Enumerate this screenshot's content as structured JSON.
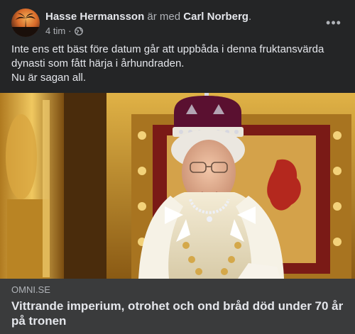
{
  "post": {
    "author": "Hasse Hermansson",
    "with_text": "är med",
    "tagged": "Carl Norberg",
    "tag_end": ".",
    "time": "4 tim",
    "dot": "·",
    "audience_icon": "globe-icon",
    "more_icon": "more-options-icon",
    "more_glyph": "•••",
    "body_lines": [
      "Inte ens ett bäst före datum går att uppbåda i denna fruktansvärda",
      "dynasti som fått härja i århundraden.",
      "Nu är sagan all."
    ]
  },
  "link_preview": {
    "domain": "OMNI.SE",
    "headline": "Vittrande imperium, otrohet och ond bråd död under 70 år på tronen"
  },
  "colors": {
    "background": "#242526",
    "preview_bg": "#3a3b3c",
    "primary_text": "#e4e6eb",
    "secondary_text": "#b0b3b8"
  }
}
